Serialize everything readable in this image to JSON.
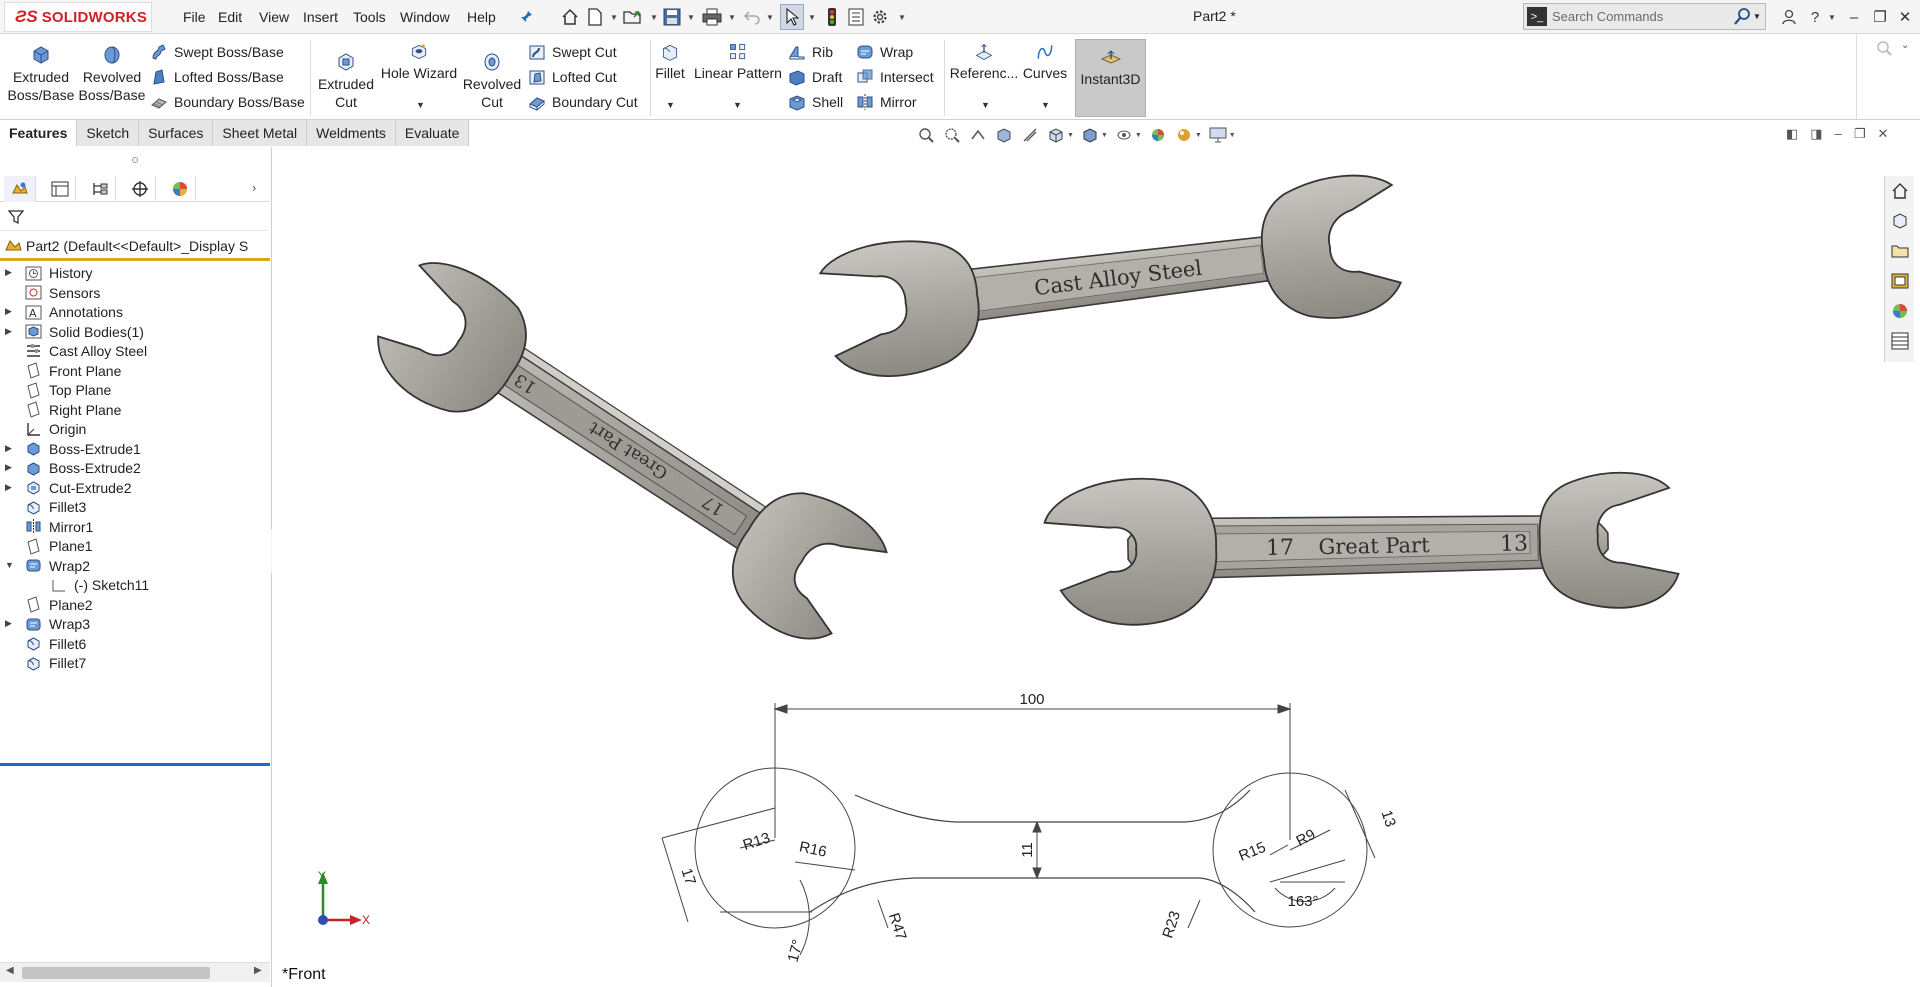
{
  "app": {
    "brand": "SOLIDWORKS",
    "document_title": "Part2 *"
  },
  "menu": [
    "File",
    "Edit",
    "View",
    "Insert",
    "Tools",
    "Window",
    "Help"
  ],
  "search": {
    "placeholder": "Search Commands"
  },
  "ribbon": {
    "extruded_boss": "Extruded Boss/Base",
    "revolved_boss": "Revolved Boss/Base",
    "swept_boss": "Swept Boss/Base",
    "lofted_boss": "Lofted Boss/Base",
    "boundary_boss": "Boundary Boss/Base",
    "extruded_cut": "Extruded Cut",
    "hole_wizard": "Hole Wizard",
    "revolved_cut": "Revolved Cut",
    "swept_cut": "Swept Cut",
    "lofted_cut": "Lofted Cut",
    "boundary_cut": "Boundary Cut",
    "fillet": "Fillet",
    "linear_pattern": "Linear Pattern",
    "rib": "Rib",
    "draft": "Draft",
    "shell": "Shell",
    "wrap": "Wrap",
    "intersect": "Intersect",
    "mirror": "Mirror",
    "reference": "Referenc...",
    "curves": "Curves",
    "instant3d": "Instant3D"
  },
  "tabs": [
    "Features",
    "Sketch",
    "Surfaces",
    "Sheet Metal",
    "Weldments",
    "Evaluate"
  ],
  "tree": {
    "part": "Part2  (Default<<Default>_Display S",
    "items": [
      {
        "label": "History",
        "icon": "history-icon",
        "expandable": true
      },
      {
        "label": "Sensors",
        "icon": "sensor-icon",
        "expandable": false
      },
      {
        "label": "Annotations",
        "icon": "annotation-icon",
        "expandable": true
      },
      {
        "label": "Solid Bodies(1)",
        "icon": "solid-bodies-icon",
        "expandable": true
      },
      {
        "label": "Cast Alloy Steel",
        "icon": "material-icon",
        "expandable": false
      },
      {
        "label": "Front Plane",
        "icon": "plane-icon",
        "expandable": false
      },
      {
        "label": "Top Plane",
        "icon": "plane-icon",
        "expandable": false
      },
      {
        "label": "Right Plane",
        "icon": "plane-icon",
        "expandable": false
      },
      {
        "label": "Origin",
        "icon": "origin-icon",
        "expandable": false
      },
      {
        "label": "Boss-Extrude1",
        "icon": "boss-extrude-icon",
        "expandable": true
      },
      {
        "label": "Boss-Extrude2",
        "icon": "boss-extrude-icon",
        "expandable": true
      },
      {
        "label": "Cut-Extrude2",
        "icon": "cut-extrude-icon",
        "expandable": true
      },
      {
        "label": "Fillet3",
        "icon": "fillet-icon",
        "expandable": false
      },
      {
        "label": "Mirror1",
        "icon": "mirror-icon",
        "expandable": false
      },
      {
        "label": "Plane1",
        "icon": "plane-icon",
        "expandable": false
      },
      {
        "label": "Wrap2",
        "icon": "wrap-icon",
        "expandable": true,
        "expanded": true
      },
      {
        "label": "(-) Sketch11",
        "icon": "sketch-icon",
        "expandable": false,
        "child": true
      },
      {
        "label": "Plane2",
        "icon": "plane-icon",
        "expandable": false
      },
      {
        "label": "Wrap3",
        "icon": "wrap-icon",
        "expandable": true
      },
      {
        "label": "Fillet6",
        "icon": "fillet-icon",
        "expandable": false
      },
      {
        "label": "Fillet7",
        "icon": "fillet-icon",
        "expandable": false
      }
    ]
  },
  "model": {
    "text_top": "Cast Alloy Steel",
    "text_right": "Great Part",
    "size_left": "17",
    "size_right": "13",
    "iso_text": "Great Part",
    "iso_left": "13",
    "iso_right": "17"
  },
  "drawing": {
    "dim_length": "100",
    "dim_width": "11",
    "r13": "R13",
    "r16": "R16",
    "r15": "R15",
    "r9": "R9",
    "r47": "R47",
    "r23": "R23",
    "jaw_left": "17",
    "jaw_right": "13",
    "angle_left": "17°",
    "angle_right": "163°"
  },
  "triad": {
    "y": "Y",
    "x": "X"
  },
  "view_name": "*Front",
  "colors": {
    "brand_red": "#d32028",
    "part_gold": "#d9a520",
    "rollback_blue": "#1e6bc0",
    "steel": "#a9a59f"
  }
}
